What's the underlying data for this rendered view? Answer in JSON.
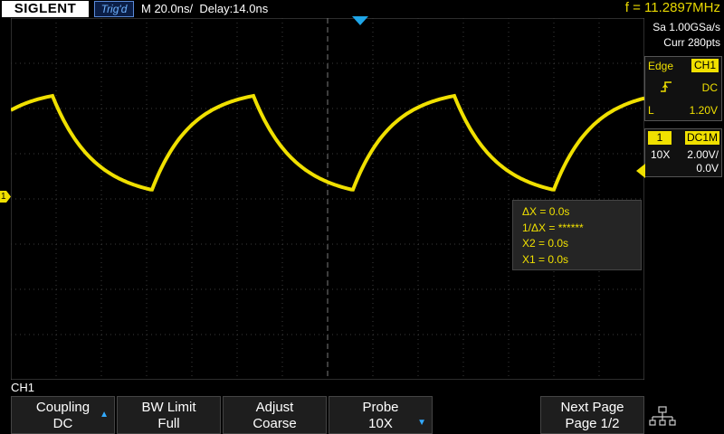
{
  "header": {
    "brand": "SIGLENT",
    "trigger_status": "Trig'd",
    "timebase": "M 20.0ns/",
    "delay": "Delay:14.0ns",
    "frequency": "f = 11.2897MHz"
  },
  "acquisition": {
    "sample_rate": "Sa 1.00GSa/s",
    "memory": "Curr 280pts"
  },
  "trigger": {
    "type": "Edge",
    "source": "CH1",
    "slope_icon": "rising-edge-icon",
    "coupling": "DC",
    "level_label": "L",
    "level": "1.20V"
  },
  "channel": {
    "number": "1",
    "coupling_impedance": "DC1M",
    "probe": "10X",
    "volts_per_div": "2.00V/",
    "offset": "0.0V",
    "marker": "1",
    "label": "CH1",
    "color": "#f0e000"
  },
  "cursor_measure": {
    "delta_x": "ΔX = 0.0s",
    "inv_delta_x": "1/ΔX = ******",
    "x2": "X2 = 0.0s",
    "x1": "X1 = 0.0s"
  },
  "softkeys": [
    {
      "title": "Coupling",
      "value": "DC",
      "arrow": "▲"
    },
    {
      "title": "BW Limit",
      "value": "Full",
      "arrow": ""
    },
    {
      "title": "Adjust",
      "value": "Coarse",
      "arrow": ""
    },
    {
      "title": "Probe",
      "value": "10X",
      "arrow": "▼"
    },
    {
      "title": "Next Page",
      "value": "Page 1/2",
      "arrow": ""
    }
  ],
  "network_icon": "network-icon"
}
